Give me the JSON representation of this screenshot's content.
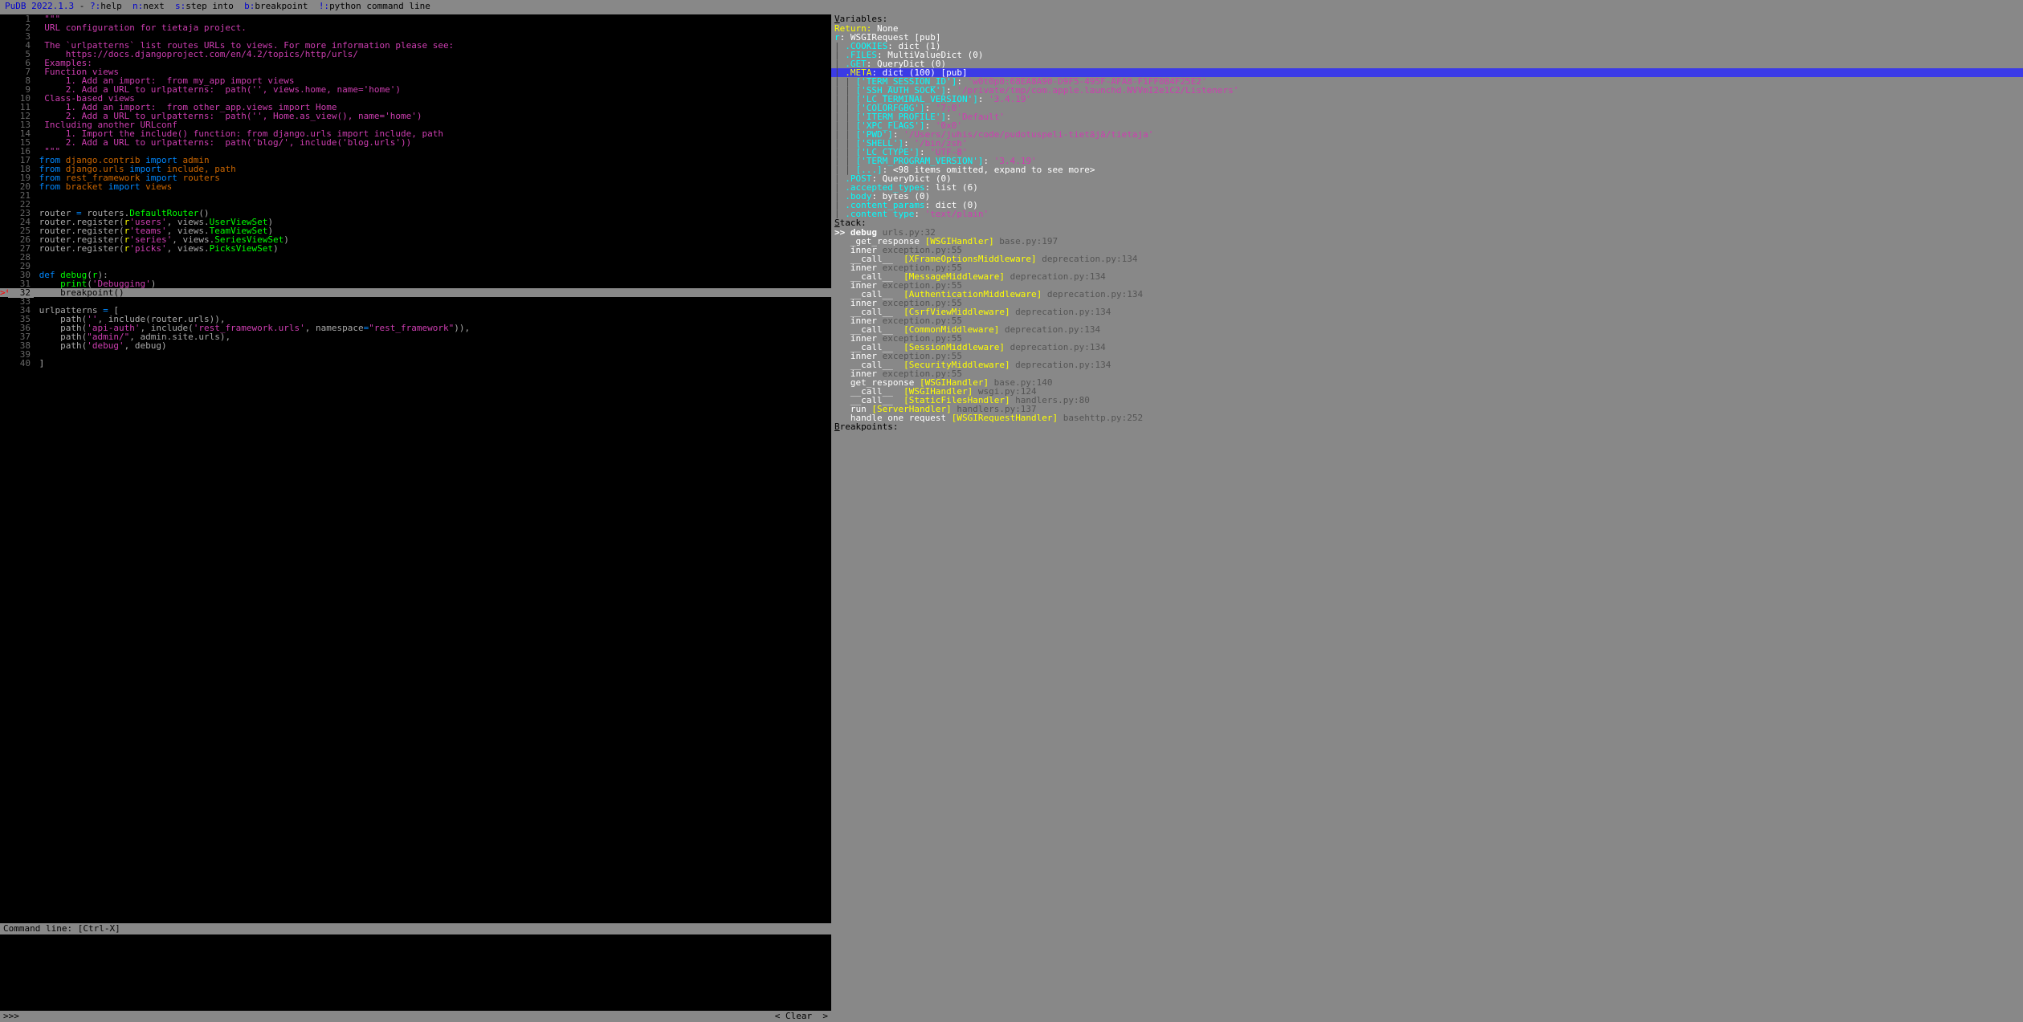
{
  "topbar": {
    "app": "PuDB 2022.1.3",
    "sep": " - ",
    "help_key": "?:",
    "help_lbl": "help",
    "next_key": "n:",
    "next_lbl": "next",
    "step_key": "s:",
    "step_lbl": "step into",
    "bp_key": "b:",
    "bp_lbl": "breakpoint",
    "py_key": "!:",
    "py_lbl": "python command line"
  },
  "code": {
    "current_line": 32,
    "lines": [
      {
        "n": 1,
        "t": "\"\"\"",
        "cls": "magenta"
      },
      {
        "n": 2,
        "t": "URL configuration for tietaja project.",
        "cls": "magenta"
      },
      {
        "n": 3,
        "t": "",
        "cls": "magenta"
      },
      {
        "n": 4,
        "t": "The `urlpatterns` list routes URLs to views. For more information please see:",
        "cls": "magenta"
      },
      {
        "n": 5,
        "t": "    https://docs.djangoproject.com/en/4.2/topics/http/urls/",
        "cls": "magenta"
      },
      {
        "n": 6,
        "t": "Examples:",
        "cls": "magenta"
      },
      {
        "n": 7,
        "t": "Function views",
        "cls": "magenta"
      },
      {
        "n": 8,
        "t": "    1. Add an import:  from my_app import views",
        "cls": "magenta"
      },
      {
        "n": 9,
        "t": "    2. Add a URL to urlpatterns:  path('', views.home, name='home')",
        "cls": "magenta"
      },
      {
        "n": 10,
        "t": "Class-based views",
        "cls": "magenta"
      },
      {
        "n": 11,
        "t": "    1. Add an import:  from other_app.views import Home",
        "cls": "magenta"
      },
      {
        "n": 12,
        "t": "    2. Add a URL to urlpatterns:  path('', Home.as_view(), name='home')",
        "cls": "magenta"
      },
      {
        "n": 13,
        "t": "Including another URLconf",
        "cls": "magenta"
      },
      {
        "n": 14,
        "t": "    1. Import the include() function: from django.urls import include, path",
        "cls": "magenta"
      },
      {
        "n": 15,
        "t": "    2. Add a URL to urlpatterns:  path('blog/', include('blog.urls'))",
        "cls": "magenta"
      },
      {
        "n": 16,
        "t": "\"\"\"",
        "cls": "magenta"
      },
      {
        "n": 17,
        "tokens": [
          [
            "from ",
            "keyword"
          ],
          [
            "django.contrib ",
            "brown"
          ],
          [
            "import ",
            "keyword"
          ],
          [
            "admin",
            "brown"
          ]
        ]
      },
      {
        "n": 18,
        "tokens": [
          [
            "from ",
            "keyword"
          ],
          [
            "django.urls ",
            "brown"
          ],
          [
            "import ",
            "keyword"
          ],
          [
            "include, path",
            "brown"
          ]
        ]
      },
      {
        "n": 19,
        "tokens": [
          [
            "from ",
            "keyword"
          ],
          [
            "rest_framework ",
            "brown"
          ],
          [
            "import ",
            "keyword"
          ],
          [
            "routers",
            "brown"
          ]
        ]
      },
      {
        "n": 20,
        "tokens": [
          [
            "from ",
            "keyword"
          ],
          [
            "bracket ",
            "brown"
          ],
          [
            "import ",
            "keyword"
          ],
          [
            "views",
            "brown"
          ]
        ]
      },
      {
        "n": 21,
        "t": ""
      },
      {
        "n": 22,
        "t": ""
      },
      {
        "n": 23,
        "tokens": [
          [
            "router ",
            "punct"
          ],
          [
            "= ",
            "keyword"
          ],
          [
            "routers",
            "punct"
          ],
          [
            ".",
            "punct"
          ],
          [
            "DefaultRouter",
            "name"
          ],
          [
            "()",
            "punct"
          ]
        ]
      },
      {
        "n": 24,
        "tokens": [
          [
            "router",
            "punct"
          ],
          [
            ".",
            "punct"
          ],
          [
            "register",
            "punct"
          ],
          [
            "(",
            "punct"
          ],
          [
            "r",
            "kwyellow"
          ],
          [
            "'users'",
            "string"
          ],
          [
            ", views",
            "punct"
          ],
          [
            ".",
            "punct"
          ],
          [
            "UserViewSet",
            "name"
          ],
          [
            ")",
            "punct"
          ]
        ]
      },
      {
        "n": 25,
        "tokens": [
          [
            "router",
            "punct"
          ],
          [
            ".",
            "punct"
          ],
          [
            "register",
            "punct"
          ],
          [
            "(",
            "punct"
          ],
          [
            "r",
            "kwyellow"
          ],
          [
            "'teams'",
            "string"
          ],
          [
            ", views",
            "punct"
          ],
          [
            ".",
            "punct"
          ],
          [
            "TeamViewSet",
            "name"
          ],
          [
            ")",
            "punct"
          ]
        ]
      },
      {
        "n": 26,
        "tokens": [
          [
            "router",
            "punct"
          ],
          [
            ".",
            "punct"
          ],
          [
            "register",
            "punct"
          ],
          [
            "(",
            "punct"
          ],
          [
            "r",
            "kwyellow"
          ],
          [
            "'series'",
            "string"
          ],
          [
            ", views",
            "punct"
          ],
          [
            ".",
            "punct"
          ],
          [
            "SeriesViewSet",
            "name"
          ],
          [
            ")",
            "punct"
          ]
        ]
      },
      {
        "n": 27,
        "tokens": [
          [
            "router",
            "punct"
          ],
          [
            ".",
            "punct"
          ],
          [
            "register",
            "punct"
          ],
          [
            "(",
            "punct"
          ],
          [
            "r",
            "kwyellow"
          ],
          [
            "'picks'",
            "string"
          ],
          [
            ", views",
            "punct"
          ],
          [
            ".",
            "punct"
          ],
          [
            "PicksViewSet",
            "name"
          ],
          [
            ")",
            "punct"
          ]
        ]
      },
      {
        "n": 28,
        "t": ""
      },
      {
        "n": 29,
        "t": ""
      },
      {
        "n": 30,
        "tokens": [
          [
            "def ",
            "keyword"
          ],
          [
            "debug",
            "name"
          ],
          [
            "(",
            "punct"
          ],
          [
            "r",
            "name"
          ],
          [
            "):",
            "punct"
          ]
        ]
      },
      {
        "n": 31,
        "tokens": [
          [
            "    ",
            "punct"
          ],
          [
            "print",
            "name"
          ],
          [
            "(",
            "punct"
          ],
          [
            "'Debugging'",
            "string"
          ],
          [
            ")",
            "punct"
          ]
        ]
      },
      {
        "n": 32,
        "tokens": [
          [
            "    ",
            "punct"
          ],
          [
            "breakpoint",
            "name"
          ],
          [
            "()",
            "punct"
          ]
        ],
        "marker": ">*",
        "current": true
      },
      {
        "n": 33,
        "t": ""
      },
      {
        "n": 34,
        "tokens": [
          [
            "urlpatterns ",
            "punct"
          ],
          [
            "= ",
            "keyword"
          ],
          [
            "[",
            "punct"
          ]
        ]
      },
      {
        "n": 35,
        "tokens": [
          [
            "    path",
            "punct"
          ],
          [
            "(",
            "punct"
          ],
          [
            "''",
            "string"
          ],
          [
            ", include",
            "punct"
          ],
          [
            "(",
            "punct"
          ],
          [
            "router",
            "punct"
          ],
          [
            ".",
            "punct"
          ],
          [
            "urls",
            "punct"
          ],
          [
            ")),",
            "punct"
          ]
        ]
      },
      {
        "n": 36,
        "tokens": [
          [
            "    path",
            "punct"
          ],
          [
            "(",
            "punct"
          ],
          [
            "'api-auth'",
            "string"
          ],
          [
            ", include",
            "punct"
          ],
          [
            "(",
            "punct"
          ],
          [
            "'rest_framework.urls'",
            "string"
          ],
          [
            ", namespace",
            "punct"
          ],
          [
            "=",
            "keyword"
          ],
          [
            "\"rest_framework\"",
            "string"
          ],
          [
            ")),",
            "punct"
          ]
        ]
      },
      {
        "n": 37,
        "tokens": [
          [
            "    path",
            "punct"
          ],
          [
            "(",
            "punct"
          ],
          [
            "\"admin/\"",
            "string"
          ],
          [
            ", admin",
            "punct"
          ],
          [
            ".",
            "punct"
          ],
          [
            "site",
            "punct"
          ],
          [
            ".",
            "punct"
          ],
          [
            "urls",
            "punct"
          ],
          [
            "),",
            "punct"
          ]
        ]
      },
      {
        "n": 38,
        "tokens": [
          [
            "    path",
            "punct"
          ],
          [
            "(",
            "punct"
          ],
          [
            "'debug'",
            "string"
          ],
          [
            ", debug",
            "punct"
          ],
          [
            ")",
            "punct"
          ]
        ]
      },
      {
        "n": 39,
        "t": ""
      },
      {
        "n": 40,
        "tokens": [
          [
            "]",
            "punct"
          ]
        ]
      }
    ]
  },
  "cmdline": {
    "header": "Command line: [Ctrl-X]",
    "prompt": ">>> ",
    "clear": "< Clear  >"
  },
  "variables": {
    "header": "Variables:",
    "return": {
      "label": "Return:",
      "val": " None"
    },
    "lines": [
      {
        "key": "r",
        "sep": ": ",
        "type": "WSGIRequest [pub]"
      },
      {
        "pre": "| ",
        "key": ".COOKIES",
        "sep": ": ",
        "type": "dict (1)"
      },
      {
        "pre": "| ",
        "key": ".FILES",
        "sep": ": ",
        "type": "MultiValueDict (0)"
      },
      {
        "pre": "| ",
        "key": ".GET",
        "sep": ": ",
        "type": "QueryDict (0)"
      },
      {
        "pre": "| ",
        "key": ".META",
        "sep": ": ",
        "type": "dict (100) [pub]",
        "hl": true,
        "kcls": "var-key-y"
      },
      {
        "pre": "| | ",
        "key": "['TERM_SESSION_ID']",
        "sep": ": ",
        "str": "'w0t0p0:68EA8A90-D9F5-495F-AFA8-F1FF0B4F25E2'"
      },
      {
        "pre": "| | ",
        "key": "['SSH_AUTH_SOCK']",
        "sep": ": ",
        "str": "'/private/tmp/com.apple.launchd.NVVmI2e1C2/Listeners'"
      },
      {
        "pre": "| | ",
        "key": "['LC_TERMINAL_VERSION']",
        "sep": ": ",
        "str": "'3.4.19'"
      },
      {
        "pre": "| | ",
        "key": "['COLORFGBG']",
        "sep": ": ",
        "str": "'7;0'"
      },
      {
        "pre": "| | ",
        "key": "['ITERM_PROFILE']",
        "sep": ": ",
        "str": "'Default'"
      },
      {
        "pre": "| | ",
        "key": "['XPC_FLAGS']",
        "sep": ": ",
        "str": "'0x0'"
      },
      {
        "pre": "| | ",
        "key": "['PWD']",
        "sep": ": ",
        "str": "'/Users/juhis/code/pudotuspeli-tietäjä/tietaja'"
      },
      {
        "pre": "| | ",
        "key": "['SHELL']",
        "sep": ": ",
        "str": "'/bin/zsh'"
      },
      {
        "pre": "| | ",
        "key": "['LC_CTYPE']",
        "sep": ": ",
        "str": "'UTF-8'"
      },
      {
        "pre": "| | ",
        "key": "['TERM_PROGRAM_VERSION']",
        "sep": ": ",
        "str": "'3.4.19'"
      },
      {
        "pre": "| | ",
        "key": "[...]",
        "sep": ": ",
        "type": "<98 items omitted, expand to see more>"
      },
      {
        "pre": "| ",
        "key": ".POST",
        "sep": ": ",
        "type": "QueryDict (0)"
      },
      {
        "pre": "| ",
        "key": ".accepted_types",
        "sep": ": ",
        "type": "list (6)"
      },
      {
        "pre": "| ",
        "key": ".body",
        "sep": ": ",
        "type": "bytes (0)"
      },
      {
        "pre": "| ",
        "key": ".content_params",
        "sep": ": ",
        "type": "dict (0)"
      },
      {
        "pre": "| ",
        "key": ".content_type",
        "sep": ": ",
        "str": "'text/plain'"
      }
    ]
  },
  "stack": {
    "header": "Stack:",
    "frames": [
      {
        "marker": ">> ",
        "fn": "debug",
        "loc": " urls.py:32",
        "bold": true
      },
      {
        "indent": "   ",
        "fn": "_get_response ",
        "br": "[WSGIHandler]",
        "loc": " base.py:197"
      },
      {
        "indent": "   ",
        "fn": "inner ",
        "loc": "exception.py:55"
      },
      {
        "indent": "   ",
        "fn": "__call__  ",
        "br": "[XFrameOptionsMiddleware]",
        "loc": " deprecation.py:134"
      },
      {
        "indent": "   ",
        "fn": "inner ",
        "loc": "exception.py:55"
      },
      {
        "indent": "   ",
        "fn": "__call__  ",
        "br": "[MessageMiddleware]",
        "loc": " deprecation.py:134"
      },
      {
        "indent": "   ",
        "fn": "inner ",
        "loc": "exception.py:55"
      },
      {
        "indent": "   ",
        "fn": "__call__  ",
        "br": "[AuthenticationMiddleware]",
        "loc": " deprecation.py:134"
      },
      {
        "indent": "   ",
        "fn": "inner ",
        "loc": "exception.py:55"
      },
      {
        "indent": "   ",
        "fn": "__call__  ",
        "br": "[CsrfViewMiddleware]",
        "loc": " deprecation.py:134"
      },
      {
        "indent": "   ",
        "fn": "inner ",
        "loc": "exception.py:55"
      },
      {
        "indent": "   ",
        "fn": "__call__  ",
        "br": "[CommonMiddleware]",
        "loc": " deprecation.py:134"
      },
      {
        "indent": "   ",
        "fn": "inner ",
        "loc": "exception.py:55"
      },
      {
        "indent": "   ",
        "fn": "__call__  ",
        "br": "[SessionMiddleware]",
        "loc": " deprecation.py:134"
      },
      {
        "indent": "   ",
        "fn": "inner ",
        "loc": "exception.py:55"
      },
      {
        "indent": "   ",
        "fn": "__call__  ",
        "br": "[SecurityMiddleware]",
        "loc": " deprecation.py:134"
      },
      {
        "indent": "   ",
        "fn": "inner ",
        "loc": "exception.py:55"
      },
      {
        "indent": "   ",
        "fn": "get_response ",
        "br": "[WSGIHandler]",
        "loc": " base.py:140"
      },
      {
        "indent": "   ",
        "fn": "__call__  ",
        "br": "[WSGIHandler]",
        "loc": " wsgi.py:124"
      },
      {
        "indent": "   ",
        "fn": "__call__  ",
        "br": "[StaticFilesHandler]",
        "loc": " handlers.py:80"
      },
      {
        "indent": "   ",
        "fn": "run ",
        "br": "[ServerHandler]",
        "loc": " handlers.py:137"
      },
      {
        "indent": "   ",
        "fn": "handle_one_request ",
        "br": "[WSGIRequestHandler]",
        "loc": " basehttp.py:252"
      }
    ]
  },
  "breakpoints": {
    "header": "Breakpoints:"
  }
}
